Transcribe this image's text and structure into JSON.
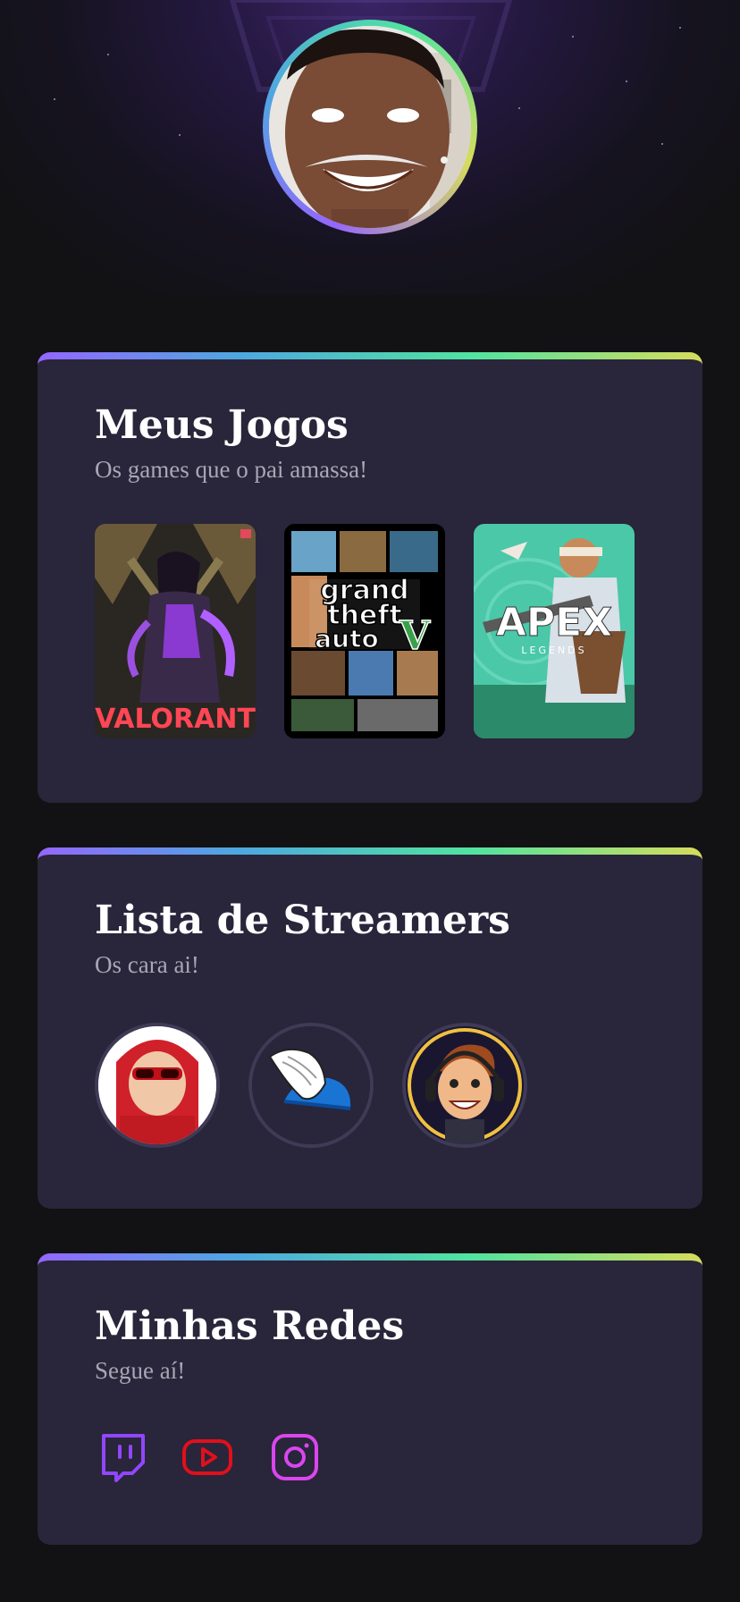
{
  "games": {
    "title": "Meus Jogos",
    "subtitle": "Os games que o pai amassa!",
    "items": [
      {
        "name": "VALORANT"
      },
      {
        "name": "grand theft auto",
        "badge": "FIVE"
      },
      {
        "name": "APEX",
        "sub": "LEGENDS"
      }
    ]
  },
  "streamers": {
    "title": "Lista de Streamers",
    "subtitle": "Os cara ai!"
  },
  "socials": {
    "title": "Minhas Redes",
    "subtitle": "Segue aí!",
    "items": [
      "twitch-icon",
      "youtube-icon",
      "instagram-icon"
    ]
  },
  "colors": {
    "background": "#121214",
    "card": "#29253a",
    "twitch": "#9146ff",
    "youtube": "#e0101b",
    "instagram": "#d946ef"
  }
}
